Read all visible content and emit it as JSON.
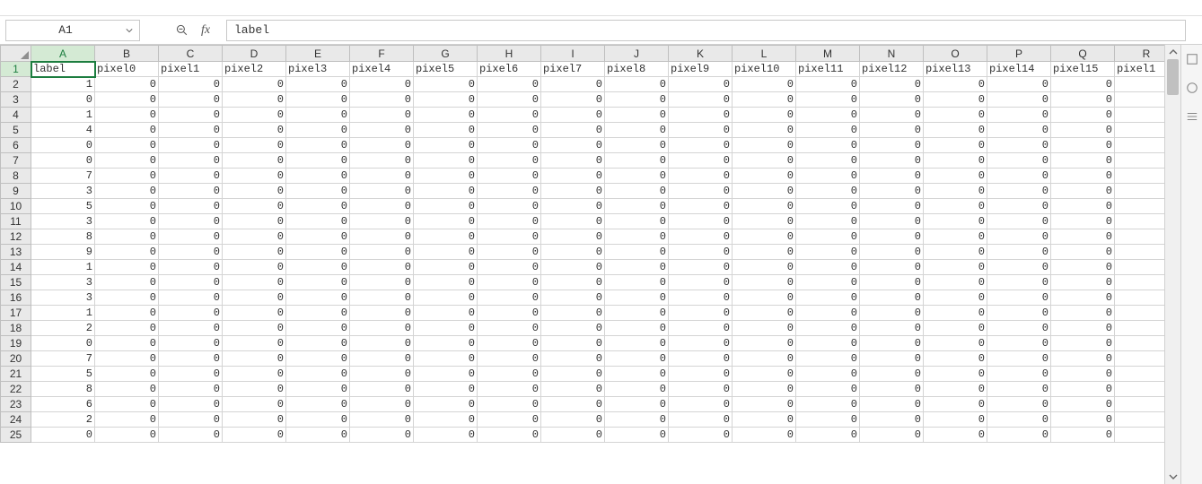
{
  "namebox": {
    "value": "A1"
  },
  "formula_bar": {
    "fx_label": "fx",
    "value": "label"
  },
  "columns": [
    "A",
    "B",
    "C",
    "D",
    "E",
    "F",
    "G",
    "H",
    "I",
    "J",
    "K",
    "L",
    "M",
    "N",
    "O",
    "P",
    "Q",
    "R"
  ],
  "active_col": "A",
  "active_row": 1,
  "row_count": 25,
  "headers_row": [
    "label",
    "pixel0",
    "pixel1",
    "pixel2",
    "pixel3",
    "pixel4",
    "pixel5",
    "pixel6",
    "pixel7",
    "pixel8",
    "pixel9",
    "pixel10",
    "pixel11",
    "pixel12",
    "pixel13",
    "pixel14",
    "pixel15",
    "pixel1"
  ],
  "data_rows": [
    [
      1,
      0,
      0,
      0,
      0,
      0,
      0,
      0,
      0,
      0,
      0,
      0,
      0,
      0,
      0,
      0,
      0,
      null
    ],
    [
      0,
      0,
      0,
      0,
      0,
      0,
      0,
      0,
      0,
      0,
      0,
      0,
      0,
      0,
      0,
      0,
      0,
      null
    ],
    [
      1,
      0,
      0,
      0,
      0,
      0,
      0,
      0,
      0,
      0,
      0,
      0,
      0,
      0,
      0,
      0,
      0,
      null
    ],
    [
      4,
      0,
      0,
      0,
      0,
      0,
      0,
      0,
      0,
      0,
      0,
      0,
      0,
      0,
      0,
      0,
      0,
      null
    ],
    [
      0,
      0,
      0,
      0,
      0,
      0,
      0,
      0,
      0,
      0,
      0,
      0,
      0,
      0,
      0,
      0,
      0,
      null
    ],
    [
      0,
      0,
      0,
      0,
      0,
      0,
      0,
      0,
      0,
      0,
      0,
      0,
      0,
      0,
      0,
      0,
      0,
      null
    ],
    [
      7,
      0,
      0,
      0,
      0,
      0,
      0,
      0,
      0,
      0,
      0,
      0,
      0,
      0,
      0,
      0,
      0,
      null
    ],
    [
      3,
      0,
      0,
      0,
      0,
      0,
      0,
      0,
      0,
      0,
      0,
      0,
      0,
      0,
      0,
      0,
      0,
      null
    ],
    [
      5,
      0,
      0,
      0,
      0,
      0,
      0,
      0,
      0,
      0,
      0,
      0,
      0,
      0,
      0,
      0,
      0,
      null
    ],
    [
      3,
      0,
      0,
      0,
      0,
      0,
      0,
      0,
      0,
      0,
      0,
      0,
      0,
      0,
      0,
      0,
      0,
      null
    ],
    [
      8,
      0,
      0,
      0,
      0,
      0,
      0,
      0,
      0,
      0,
      0,
      0,
      0,
      0,
      0,
      0,
      0,
      null
    ],
    [
      9,
      0,
      0,
      0,
      0,
      0,
      0,
      0,
      0,
      0,
      0,
      0,
      0,
      0,
      0,
      0,
      0,
      null
    ],
    [
      1,
      0,
      0,
      0,
      0,
      0,
      0,
      0,
      0,
      0,
      0,
      0,
      0,
      0,
      0,
      0,
      0,
      null
    ],
    [
      3,
      0,
      0,
      0,
      0,
      0,
      0,
      0,
      0,
      0,
      0,
      0,
      0,
      0,
      0,
      0,
      0,
      null
    ],
    [
      3,
      0,
      0,
      0,
      0,
      0,
      0,
      0,
      0,
      0,
      0,
      0,
      0,
      0,
      0,
      0,
      0,
      null
    ],
    [
      1,
      0,
      0,
      0,
      0,
      0,
      0,
      0,
      0,
      0,
      0,
      0,
      0,
      0,
      0,
      0,
      0,
      null
    ],
    [
      2,
      0,
      0,
      0,
      0,
      0,
      0,
      0,
      0,
      0,
      0,
      0,
      0,
      0,
      0,
      0,
      0,
      null
    ],
    [
      0,
      0,
      0,
      0,
      0,
      0,
      0,
      0,
      0,
      0,
      0,
      0,
      0,
      0,
      0,
      0,
      0,
      null
    ],
    [
      7,
      0,
      0,
      0,
      0,
      0,
      0,
      0,
      0,
      0,
      0,
      0,
      0,
      0,
      0,
      0,
      0,
      null
    ],
    [
      5,
      0,
      0,
      0,
      0,
      0,
      0,
      0,
      0,
      0,
      0,
      0,
      0,
      0,
      0,
      0,
      0,
      null
    ],
    [
      8,
      0,
      0,
      0,
      0,
      0,
      0,
      0,
      0,
      0,
      0,
      0,
      0,
      0,
      0,
      0,
      0,
      null
    ],
    [
      6,
      0,
      0,
      0,
      0,
      0,
      0,
      0,
      0,
      0,
      0,
      0,
      0,
      0,
      0,
      0,
      0,
      null
    ],
    [
      2,
      0,
      0,
      0,
      0,
      0,
      0,
      0,
      0,
      0,
      0,
      0,
      0,
      0,
      0,
      0,
      0,
      null
    ],
    [
      0,
      0,
      0,
      0,
      0,
      0,
      0,
      0,
      0,
      0,
      0,
      0,
      0,
      0,
      0,
      0,
      0,
      null
    ]
  ]
}
